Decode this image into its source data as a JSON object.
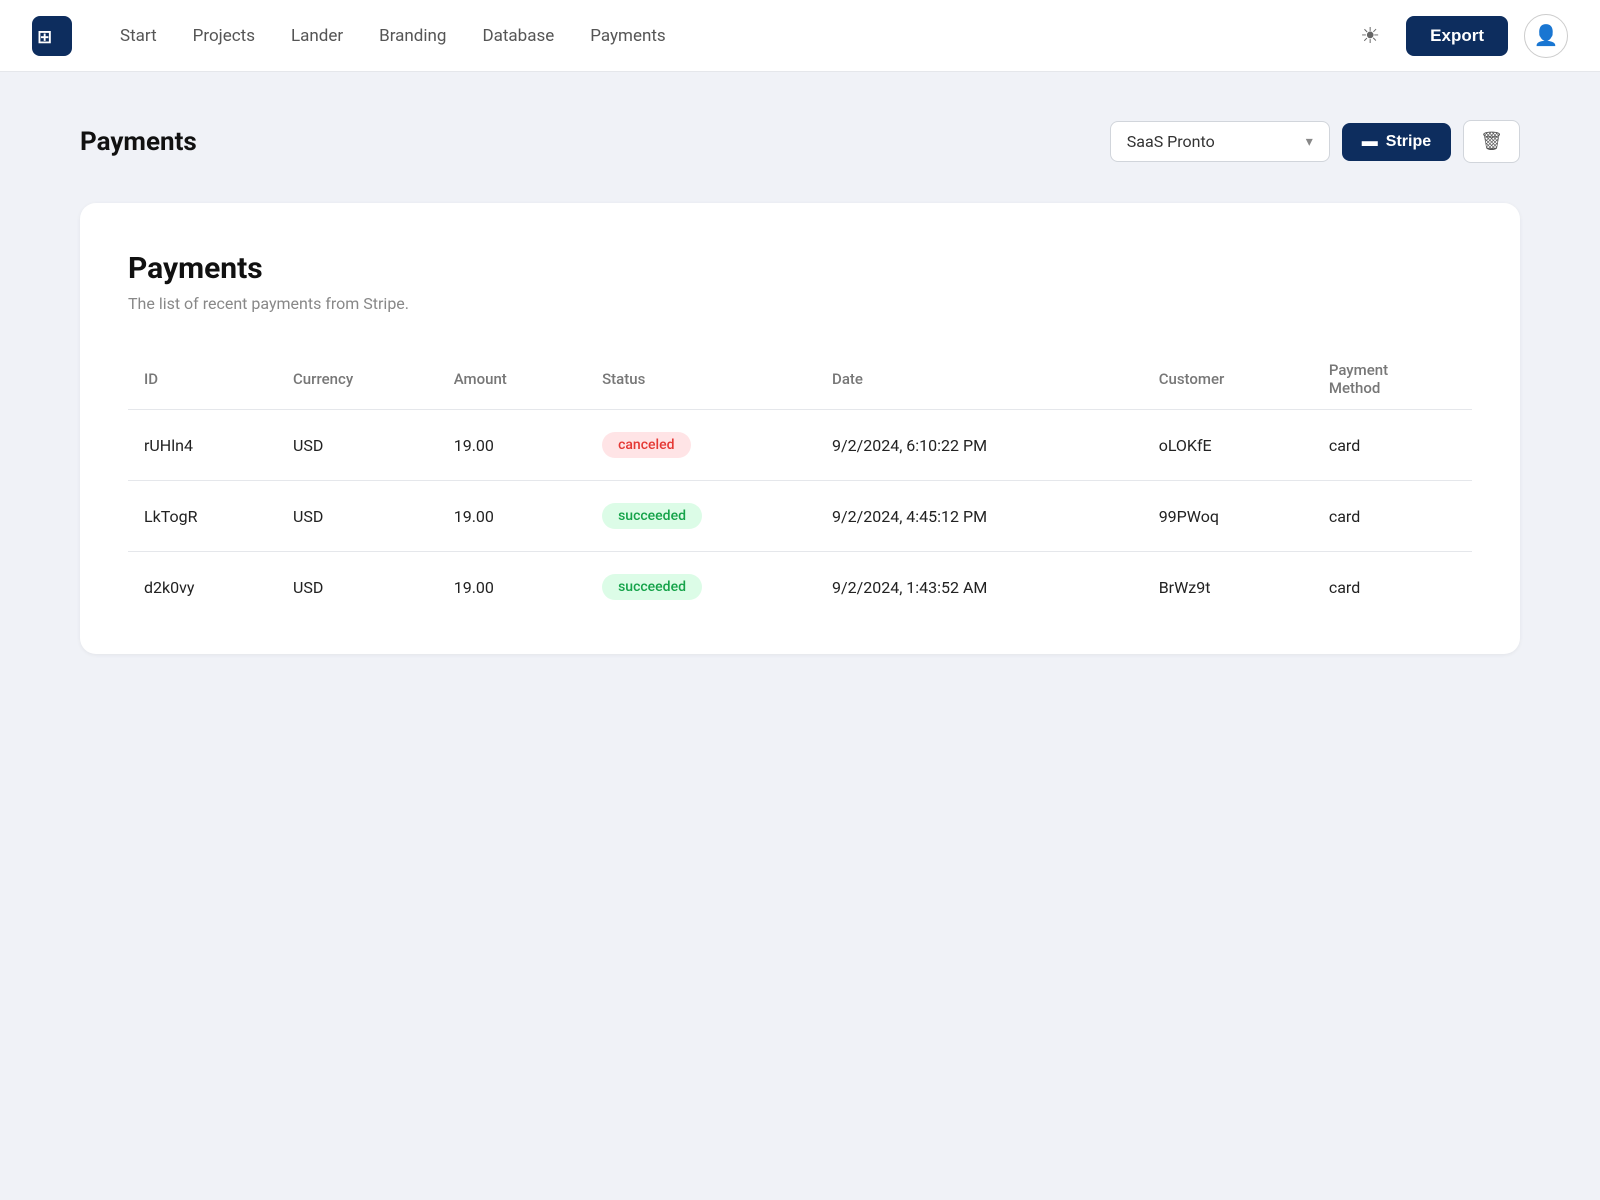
{
  "navbar": {
    "links": [
      {
        "label": "Start",
        "name": "nav-start"
      },
      {
        "label": "Projects",
        "name": "nav-projects"
      },
      {
        "label": "Lander",
        "name": "nav-lander"
      },
      {
        "label": "Branding",
        "name": "nav-branding"
      },
      {
        "label": "Database",
        "name": "nav-database"
      },
      {
        "label": "Payments",
        "name": "nav-payments"
      }
    ],
    "export_label": "Export"
  },
  "page": {
    "title": "Payments"
  },
  "selector": {
    "project": "SaaS Pronto"
  },
  "stripe_button": "Stripe",
  "card": {
    "title": "Payments",
    "subtitle": "The list of recent payments from Stripe.",
    "table": {
      "columns": [
        "ID",
        "Currency",
        "Amount",
        "Status",
        "Date",
        "Customer",
        "Payment Method"
      ],
      "rows": [
        {
          "id": "rUHln4",
          "currency": "USD",
          "amount": "19.00",
          "status": "canceled",
          "status_type": "canceled",
          "date": "9/2/2024, 6:10:22 PM",
          "customer": "oLOKfE",
          "payment_method": "card"
        },
        {
          "id": "LkTogR",
          "currency": "USD",
          "amount": "19.00",
          "status": "succeeded",
          "status_type": "succeeded",
          "date": "9/2/2024, 4:45:12 PM",
          "customer": "99PWoq",
          "payment_method": "card"
        },
        {
          "id": "d2k0vy",
          "currency": "USD",
          "amount": "19.00",
          "status": "succeeded",
          "status_type": "succeeded",
          "date": "9/2/2024, 1:43:52 AM",
          "customer": "BrWz9t",
          "payment_method": "card"
        }
      ]
    }
  }
}
